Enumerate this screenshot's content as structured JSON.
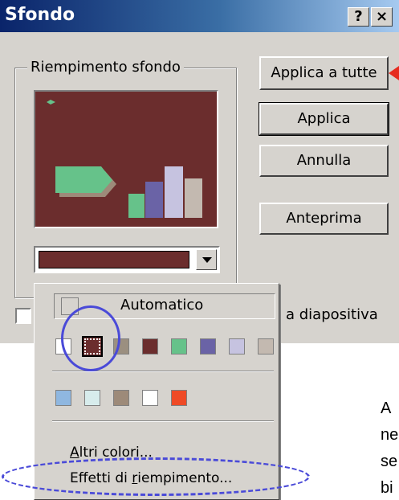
{
  "window": {
    "title": "Sfondo",
    "help_label": "?",
    "close_label": "×"
  },
  "group": {
    "label": "Riempimento sfondo"
  },
  "buttons": {
    "apply_all": "Applica a tutte",
    "apply": "Applica",
    "cancel": "Annulla",
    "preview": "Anteprima"
  },
  "combo": {
    "selected_color": "#6b2d2d"
  },
  "checkbox": {
    "label_fragment": "a diapositiva"
  },
  "popup": {
    "automatic_label": "Automatico",
    "scheme_colors": [
      "#ffffff",
      "#6b2d2d",
      "#9b8f80",
      "#6b2d2d",
      "#66c28a",
      "#6a63a6",
      "#c6c3e0",
      "#c3b9b0"
    ],
    "recent_colors": [
      "#8fb7e0",
      "#d7ecec",
      "#9d8a79",
      "#ffffff",
      "#ef4a26"
    ],
    "more_colors": {
      "accel": "A",
      "rest": "ltri colori..."
    },
    "fill_effects": {
      "before": "Effetti di ",
      "accel": "r",
      "rest": "iempimento..."
    }
  },
  "annotation": {
    "side_text": [
      "A",
      "ne",
      "se",
      "bi"
    ],
    "accent_color": "#4a4ad8",
    "arrow_color": "#e62b1e"
  }
}
